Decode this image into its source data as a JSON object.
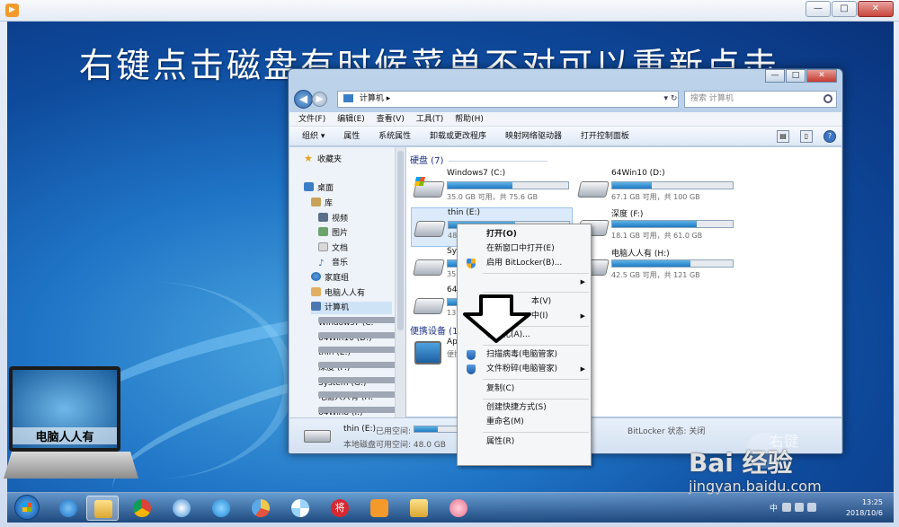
{
  "headline": "右键点击磁盘有时候菜单不对可以重新点击",
  "explorer": {
    "address": [
      "计算机",
      "▸"
    ],
    "search_placeholder": "搜索 计算机",
    "menubar": [
      "文件(F)",
      "编辑(E)",
      "查看(V)",
      "工具(T)",
      "帮助(H)"
    ],
    "toolbar": [
      "组织 ▾",
      "属性",
      "系统属性",
      "卸载或更改程序",
      "映射网络驱动器",
      "打开控制面板"
    ],
    "nav": [
      {
        "label": "收藏夹",
        "icon": "star-icon"
      },
      {
        "label": "桌面",
        "icon": "desktop-icon"
      },
      {
        "label": "库",
        "icon": "library-icon"
      },
      {
        "label": "视频",
        "icon": "video-icon"
      },
      {
        "label": "图片",
        "icon": "picture-icon"
      },
      {
        "label": "文档",
        "icon": "document-icon"
      },
      {
        "label": "音乐",
        "icon": "music-icon"
      },
      {
        "label": "家庭组",
        "icon": "homegroup-icon"
      },
      {
        "label": "电脑人人有",
        "icon": "user-folder-icon"
      },
      {
        "label": "计算机",
        "icon": "computer-icon"
      },
      {
        "label": "Windows7 (C:",
        "icon": "drive-icon"
      },
      {
        "label": "64Win10 (D:)",
        "icon": "drive-icon"
      },
      {
        "label": "thin (E:)",
        "icon": "drive-icon"
      },
      {
        "label": "深度 (F:)",
        "icon": "drive-icon"
      },
      {
        "label": "System (G:)",
        "icon": "drive-icon"
      },
      {
        "label": "电脑人人有 (H:",
        "icon": "drive-icon"
      },
      {
        "label": "64Win8 (I:)",
        "icon": "drive-icon"
      }
    ],
    "groups": {
      "hard_disks": "硬盘 (7)",
      "portable": "便携设备 (1"
    },
    "drives": [
      {
        "name": "Windows7 (C:)",
        "free": "35.0 GB 可用，共 75.6 GB",
        "used_fraction": 0.54
      },
      {
        "name": "64Win10 (D:)",
        "free": "67.1 GB 可用，共 100 GB",
        "used_fraction": 0.33
      },
      {
        "name": "thin (E:)",
        "free": "48.0",
        "used_fraction": 0.55
      },
      {
        "name": "深度 (F:)",
        "free": "18.1 GB 可用，共 61.0 GB",
        "used_fraction": 0.7
      },
      {
        "name": "Syst",
        "free": "35.3",
        "used_fraction": 0.3
      },
      {
        "name": "电脑人人有 (H:)",
        "free": "42.5 GB 可用，共 121 GB",
        "used_fraction": 0.65
      },
      {
        "name": "64W",
        "free": "13.2",
        "used_fraction": 0.4
      }
    ],
    "device": {
      "name": "App",
      "sub": "便携"
    },
    "details": {
      "name": "thin (E:)",
      "used_label": "已用空间:",
      "type": "本地磁盘",
      "free": "可用空间: 48.0 GB",
      "bitlocker": "BitLocker 状态: 关闭"
    }
  },
  "context_menu": [
    {
      "label": "打开(O)",
      "bold": true
    },
    {
      "label": "在新窗口中打开(E)"
    },
    {
      "label": "启用 BitLocker(B)...",
      "icon": "bitlocker-shield-icon"
    },
    {
      "label": "",
      "submenu": true
    },
    {
      "label": "本(V)"
    },
    {
      "label": "中(I)",
      "submenu": true
    },
    {
      "label": "格式化(A)..."
    },
    {
      "label": "扫描病毒(电脑管家)",
      "icon": "scan-shield-icon"
    },
    {
      "label": "文件粉碎(电脑管家)",
      "icon": "shred-shield-icon",
      "submenu": true
    },
    {
      "label": "复制(C)"
    },
    {
      "label": "创建快捷方式(S)"
    },
    {
      "label": "重命名(M)"
    },
    {
      "label": "属性(R)"
    }
  ],
  "laptop_caption": "电脑人人有",
  "watermark": {
    "brand": "Bai 经验",
    "url": "jingyan.baidu.com",
    "overlay": "右键"
  },
  "taskbar": {
    "apps": [
      "windows-explorer-icon",
      "ie-icon",
      "explorer-folder-icon",
      "chrome-icon",
      "media-icon",
      "browser-icon",
      "paint-icon",
      "pinwheel-icon",
      "jiang-icon",
      "player-icon",
      "folder-icon",
      "pig-icon"
    ],
    "lang": "中",
    "time": "13:25",
    "date": "2018/10/6"
  },
  "colors": {
    "accent": "#1f7ac2",
    "desktop": "#1f74c6"
  }
}
